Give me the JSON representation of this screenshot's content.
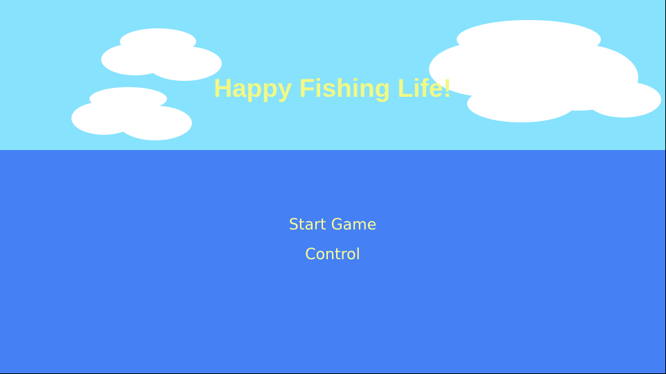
{
  "title": "Happy Fishing Life!",
  "menu": {
    "start_label": "Start Game",
    "control_label": "Control"
  },
  "colors": {
    "sky": "#87E2FD",
    "sea": "#4580F5",
    "cloud": "#FFFFFF",
    "title": "#F1F985",
    "menu_text": "#FBFB96"
  }
}
